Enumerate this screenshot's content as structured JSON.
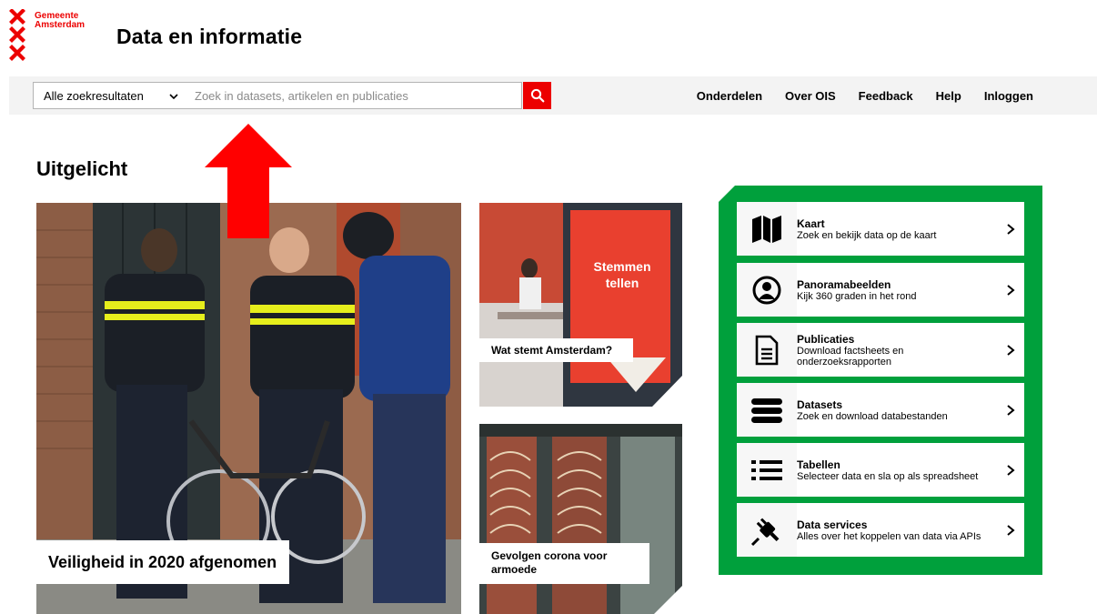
{
  "brand": {
    "logo_line1": "Gemeente",
    "logo_line2": "Amsterdam",
    "app_title": "Data en informatie",
    "accent_red": "#ec0000",
    "accent_green": "#00a03c"
  },
  "search": {
    "scope_value": "Alle zoekresultaten",
    "placeholder": "Zoek in datasets, artikelen en publicaties",
    "value": ""
  },
  "nav": {
    "links": [
      "Onderdelen",
      "Over OIS",
      "Feedback",
      "Help",
      "Inloggen"
    ]
  },
  "featured": {
    "heading": "Uitgelicht",
    "main_card": "Veiligheid in 2020 afgenomen",
    "card_1": "Wat stemt Amsterdam?",
    "card_1_sign_line1": "Stemmen",
    "card_1_sign_line2": "tellen",
    "card_2": "Gevolgen corona voor armoede"
  },
  "tiles": [
    {
      "title": "Kaart",
      "subtitle": "Zoek en bekijk data op de kaart",
      "icon": "map-icon"
    },
    {
      "title": "Panoramabeelden",
      "subtitle": "Kijk 360 graden in het rond",
      "icon": "panorama-icon"
    },
    {
      "title": "Publicaties",
      "subtitle": "Download factsheets en onderzoeksrapporten",
      "icon": "document-icon"
    },
    {
      "title": "Datasets",
      "subtitle": "Zoek en download databestanden",
      "icon": "database-icon"
    },
    {
      "title": "Tabellen",
      "subtitle": "Selecteer data en sla op als spreadsheet",
      "icon": "list-icon"
    },
    {
      "title": "Data services",
      "subtitle": "Alles over het koppelen van data via APIs",
      "icon": "plug-icon"
    }
  ]
}
